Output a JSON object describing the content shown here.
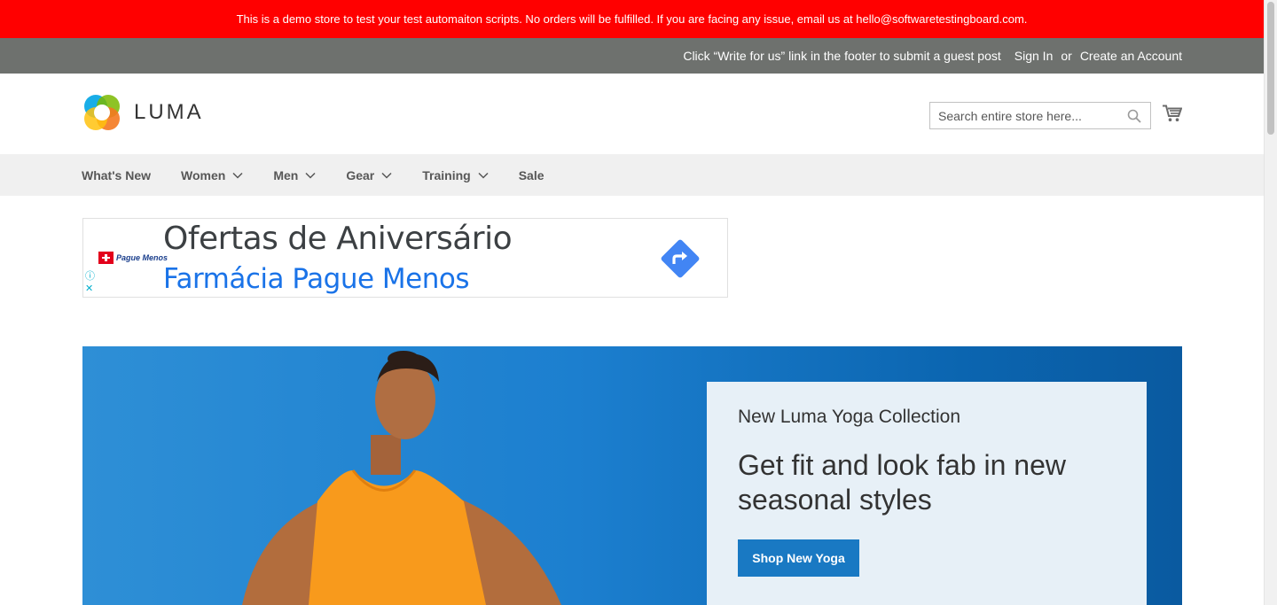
{
  "demo_notice": "This is a demo store to test your test automaiton scripts. No orders will be fulfilled. If you are facing any issue, email us at hello@softwaretestingboard.com.",
  "top_links": {
    "guest_post": "Click “Write for us” link in the footer to submit a guest post",
    "sign_in": "Sign In",
    "or": "or",
    "create_account": "Create an Account"
  },
  "header": {
    "logo_text": "LUMA",
    "search_placeholder": "Search entire store here...",
    "icons": [
      "luma-logo-icon",
      "search-icon",
      "cart-icon"
    ]
  },
  "nav": {
    "items": [
      {
        "label": "What's New",
        "has_dropdown": false
      },
      {
        "label": "Women",
        "has_dropdown": true
      },
      {
        "label": "Men",
        "has_dropdown": true
      },
      {
        "label": "Gear",
        "has_dropdown": true
      },
      {
        "label": "Training",
        "has_dropdown": true
      },
      {
        "label": "Sale",
        "has_dropdown": false
      }
    ]
  },
  "ad": {
    "brand": "Pague Menos",
    "title": "Ofertas de Aniversário",
    "subtitle": "Farmácia Pague Menos",
    "info_icon": "ⓘ",
    "close_icon": "✕",
    "accent_color": "#1a73e8"
  },
  "hero": {
    "kicker": "New Luma Yoga Collection",
    "title": "Get fit and look fab in new seasonal styles",
    "button": "Shop New Yoga",
    "button_color": "#1979c3"
  },
  "colors": {
    "demo_bar": "#ff0000",
    "top_bar": "#6e716e",
    "nav_bar": "#f0f0f0"
  }
}
